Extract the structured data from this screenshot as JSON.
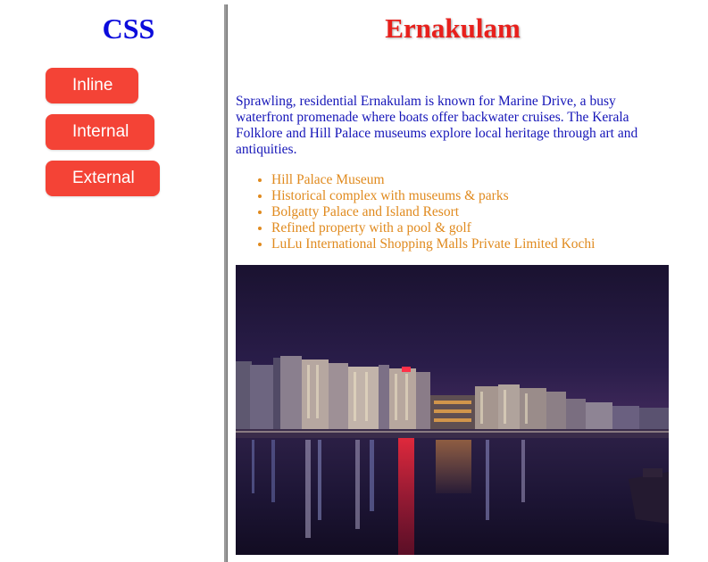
{
  "sidebar": {
    "title": "CSS",
    "buttons": [
      {
        "label": "Inline"
      },
      {
        "label": "Internal"
      },
      {
        "label": "External"
      }
    ],
    "button_color": "#f44336",
    "title_color": "#0b0bdc"
  },
  "main": {
    "title": "Ernakulam",
    "title_color": "#e8201c",
    "description": "Sprawling, residential Ernakulam is known for Marine Drive, a busy waterfront promenade where boats offer backwater cruises. The Kerala Folklore and Hill Palace museums explore local heritage through art and antiquities.",
    "description_color": "#1515b8",
    "places": [
      "Hill Palace Museum",
      "Historical complex with museums & parks",
      "Bolgatty Palace and Island Resort",
      "Refined property with a pool & golf",
      "LuLu International Shopping Malls Private Limited Kochi"
    ],
    "places_color": "#e08a1e"
  }
}
